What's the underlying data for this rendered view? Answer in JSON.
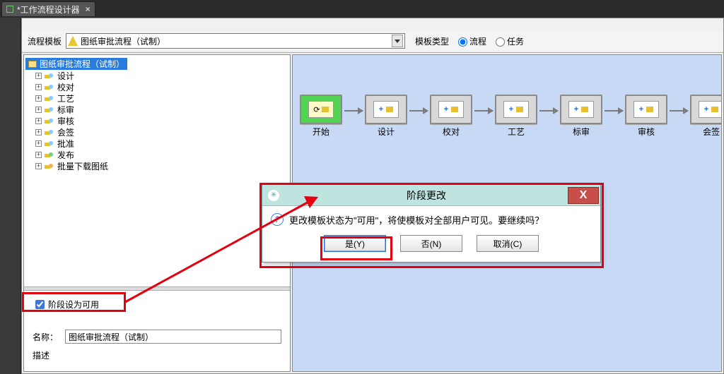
{
  "tab": {
    "title": "*工作流程设计器",
    "close": "×"
  },
  "toolbar": {
    "template_label": "流程模板",
    "template_value": "图纸审批流程（试制）",
    "type_label": "模板类型",
    "radio_flow": "流程",
    "radio_task": "任务"
  },
  "tree": {
    "root": "图纸审批流程（试制）",
    "items": [
      {
        "label": "设计"
      },
      {
        "label": "校对"
      },
      {
        "label": "工艺"
      },
      {
        "label": "标审"
      },
      {
        "label": "审核"
      },
      {
        "label": "会签"
      },
      {
        "label": "批准"
      },
      {
        "label": "发布"
      },
      {
        "label": "批量下载图纸"
      }
    ]
  },
  "props": {
    "enable_stage_label": "阶段设为可用",
    "name_label": "名称：",
    "name_value": "图纸审批流程（试制）",
    "desc_label": "描述"
  },
  "flow": {
    "start": "开始",
    "nodes": [
      "设计",
      "校对",
      "工艺",
      "标审",
      "审核",
      "会签"
    ]
  },
  "dialog": {
    "title": "阶段更改",
    "message": "更改模板状态为\"可用\"，将使模板对全部用户可见。要继续吗？",
    "yes": "是(Y)",
    "no": "否(N)",
    "cancel": "取消(C)",
    "close": "X"
  }
}
